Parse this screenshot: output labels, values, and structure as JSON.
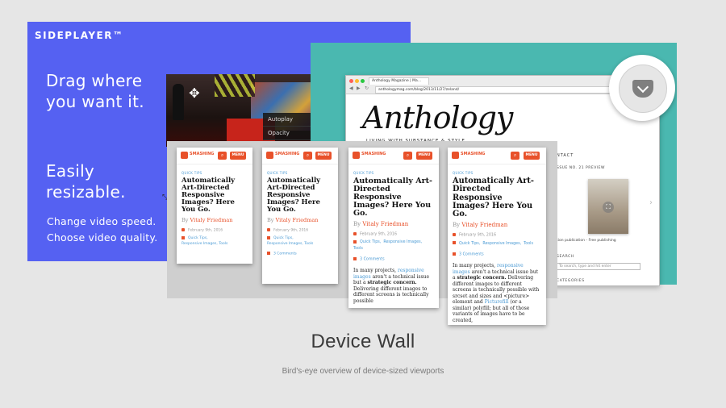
{
  "sideplayer": {
    "brand": "SIDEPLAYER™",
    "headline1": "Drag where\nyou want it.",
    "headline2": "Easily\nresizable.",
    "line1": "Change video speed.",
    "line2": "Choose video quality.",
    "video_menu": [
      "Autoplay",
      "Opacity"
    ],
    "bg_color": "#5561f2",
    "icons": [
      "move-icon",
      "resize-icon"
    ]
  },
  "anthology": {
    "tab_title": "Anthology Magazine | Ma...",
    "url": "anthologymag.com/blog/2013/11/27/zeland/",
    "logo": "Anthology",
    "tagline": "LIVING WITH SUBSTANCE & STYLE",
    "contact": "NTACT",
    "preview": "SSUE NO. 21 PREVIEW",
    "pub": "tion publication - Free publishing",
    "search_label": "SEARCH",
    "search_placeholder": "To search, type and hit enter",
    "categories": "CATEGORIES",
    "bg_color": "#4ab8b0"
  },
  "pocket": {
    "icon": "pocket-save-icon"
  },
  "devices": {
    "logo": "SMASHING",
    "menu": "MENU",
    "tips": "QUICK TIPS",
    "title": "Automatically Art-Directed Responsive Images? Here You Go.",
    "by": "By",
    "author": "Vitaly Friedman",
    "date": "February 9th, 2016",
    "tag1": "Quick Tips",
    "tag2": "Responsive Images",
    "tag3": "Tools",
    "comments": "3 Comments",
    "body3": {
      "p1": "In many projects, ",
      "l1": "responsive images",
      "p2": " aren't a technical issue but a ",
      "b1": "strategic concern.",
      "p3": " Delivering different images to different screens is technically possible"
    },
    "body4": {
      "p1": "In many projects, ",
      "l1": "responsive images",
      "p2": " aren't a technical issue but a ",
      "b1": "strategic concern.",
      "p3": " Delivering different images to different screens is technically possible with srcset and sizes and <picture> element and ",
      "l2": "Picturefill",
      "p4": " (or a similar) polyfill; but all of those variants of images have to be created,"
    },
    "accent": "#e8512a",
    "link_color": "#4a9ad4"
  },
  "caption": "Device Wall",
  "subcaption": "Bird's-eye overview of device-sized viewports"
}
